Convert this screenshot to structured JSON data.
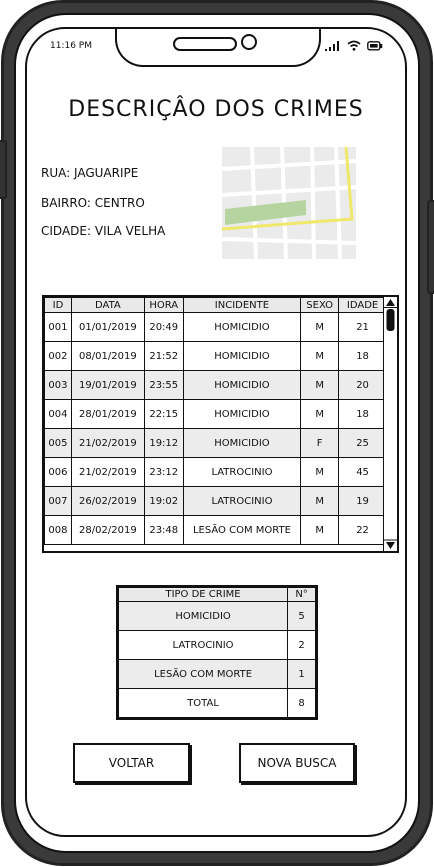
{
  "status_bar": {
    "time": "11:16 PM",
    "icons": [
      "signal-icon",
      "wifi-icon",
      "battery-icon"
    ]
  },
  "page": {
    "title": "DESCRIÇÂO DOS CRIMES"
  },
  "location": {
    "street_label": "RUA:",
    "street": "JAGUARIPE",
    "district_label": "BAIRRO:",
    "district": "CENTRO",
    "city_label": "CIDADE:",
    "city": "VILA VELHA"
  },
  "crimes_table": {
    "headers": [
      "ID",
      "DATA",
      "HORA",
      "INCIDENTE",
      "SEXO",
      "IDADE"
    ],
    "rows": [
      [
        "001",
        "01/01/2019",
        "20:49",
        "HOMICIDIO",
        "M",
        "21"
      ],
      [
        "002",
        "08/01/2019",
        "21:52",
        "HOMICIDIO",
        "M",
        "18"
      ],
      [
        "003",
        "19/01/2019",
        "23:55",
        "HOMICIDIO",
        "M",
        "20"
      ],
      [
        "004",
        "28/01/2019",
        "22:15",
        "HOMICIDIO",
        "M",
        "18"
      ],
      [
        "005",
        "21/02/2019",
        "19:12",
        "HOMICIDIO",
        "F",
        "25"
      ],
      [
        "006",
        "21/02/2019",
        "23:12",
        "LATROCINIO",
        "M",
        "45"
      ],
      [
        "007",
        "26/02/2019",
        "19:02",
        "LATROCINIO",
        "M",
        "19"
      ],
      [
        "008",
        "28/02/2019",
        "23:48",
        "LESÃO COM MORTE",
        "M",
        "22"
      ]
    ]
  },
  "summary_table": {
    "headers": [
      "TIPO DE CRIME",
      "N°"
    ],
    "rows": [
      [
        "HOMICIDIO",
        "5"
      ],
      [
        "LATROCINIO",
        "2"
      ],
      [
        "LESÃO COM MORTE",
        "1"
      ],
      [
        "TOTAL",
        "8"
      ]
    ]
  },
  "buttons": {
    "back": "VOLTAR",
    "new_search": "NOVA BUSCA"
  },
  "colors": {
    "map_park": "#b5d4a0",
    "map_route": "#f0e86a",
    "row_alt": "#ececec"
  }
}
